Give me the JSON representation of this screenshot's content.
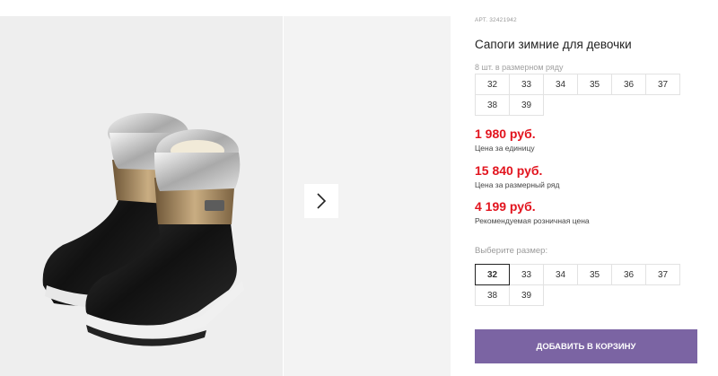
{
  "gallery": {
    "next_icon": "chevron-right-icon",
    "background": "#eeeeee"
  },
  "product": {
    "article": "АРТ. 32421942",
    "title": "Сапоги зимние для девочки",
    "pack_note": "8 шт. в размерном ряду",
    "pack_sizes": [
      "32",
      "33",
      "34",
      "35",
      "36",
      "37",
      "38",
      "39"
    ]
  },
  "prices": [
    {
      "value": "1 980 руб.",
      "label": "Цена за единицу"
    },
    {
      "value": "15 840 руб.",
      "label": "Цена за размерный ряд"
    },
    {
      "value": "4 199 руб.",
      "label": "Рекомендуемая розничная цена"
    }
  ],
  "size_select": {
    "label": "Выберите размер:",
    "options": [
      "32",
      "33",
      "34",
      "35",
      "36",
      "37",
      "38",
      "39"
    ],
    "selected": "32"
  },
  "cart_button": "ДОБАВИТЬ В КОРЗИНУ",
  "colors": {
    "price": "#e2141e",
    "cart_button": "#7b64a3"
  }
}
